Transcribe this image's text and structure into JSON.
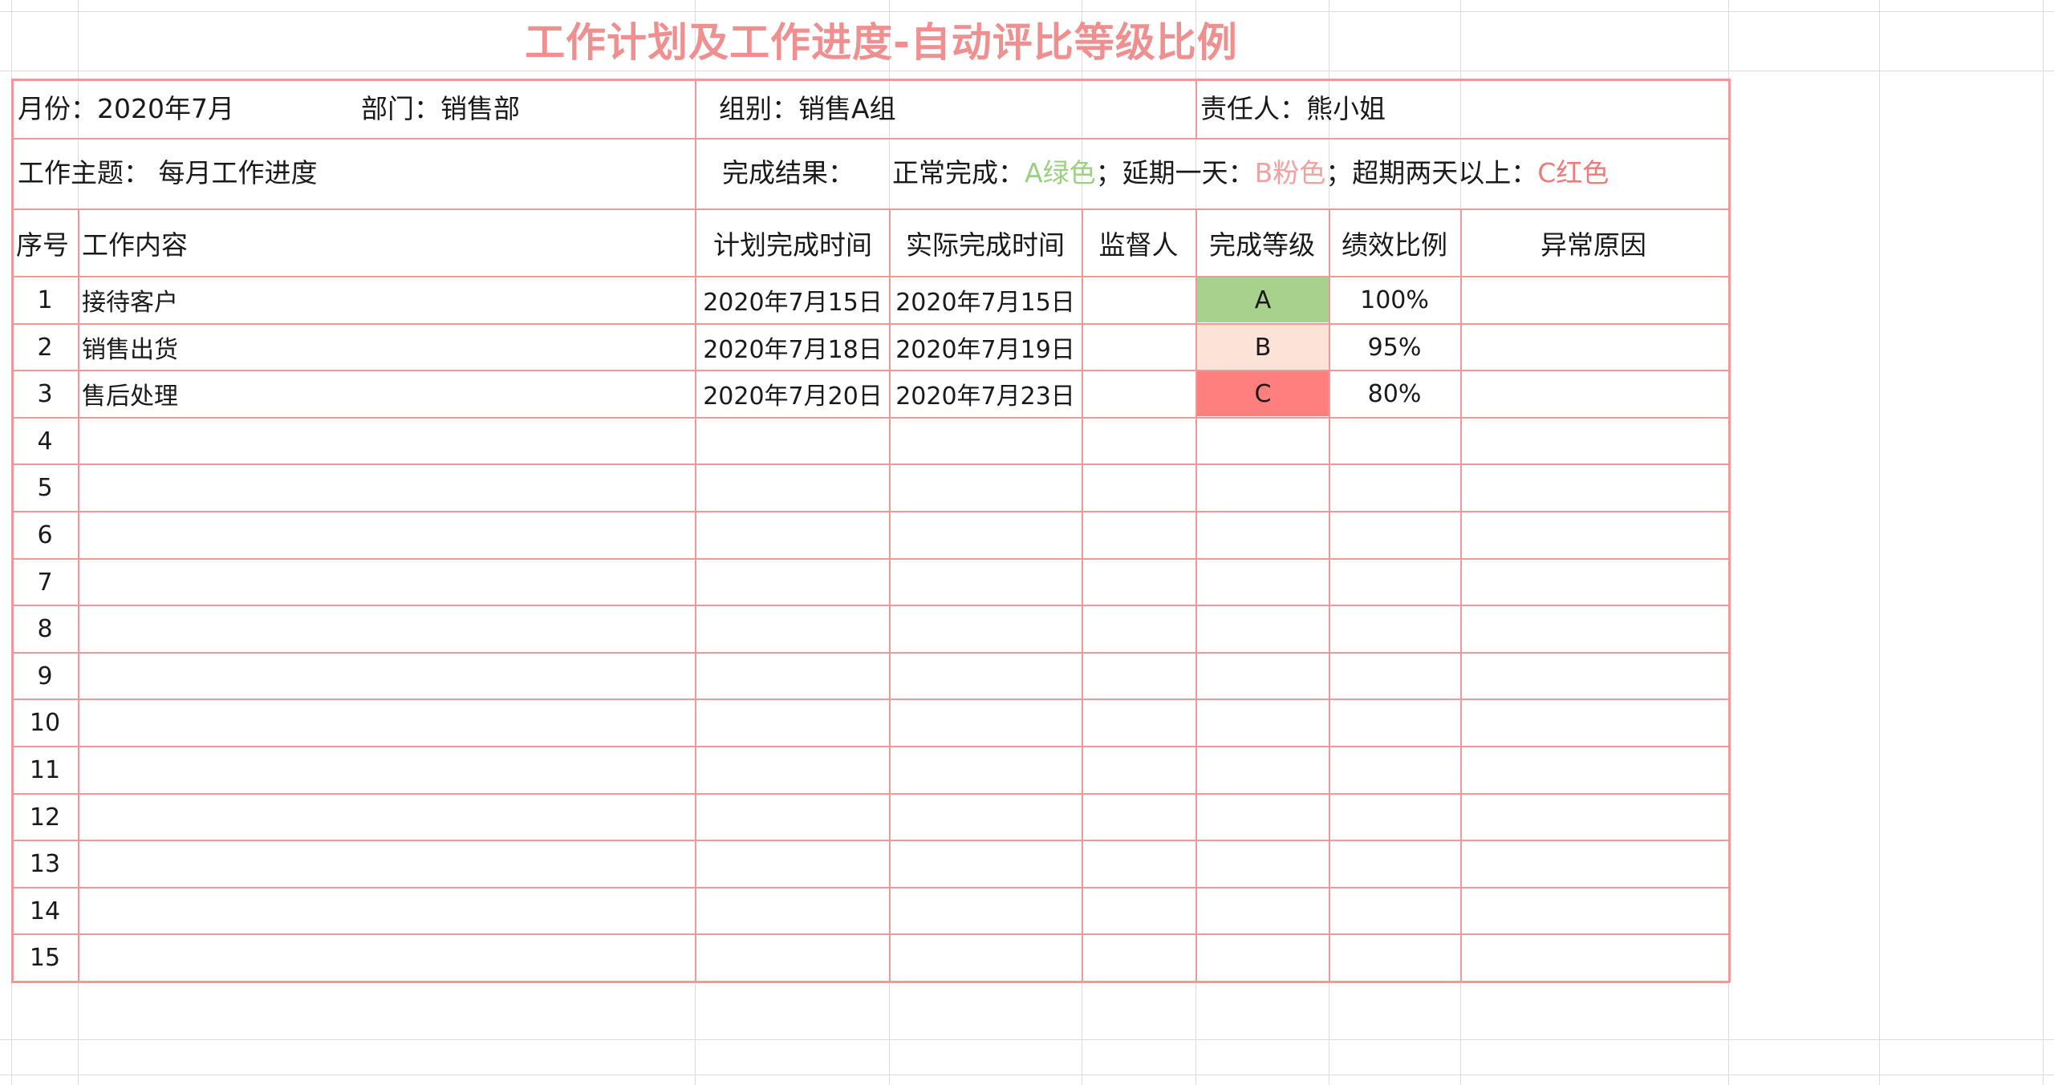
{
  "title": "工作计划及工作进度-自动评比等级比例",
  "info": {
    "month": "月份：2020年7月",
    "department": "部门：销售部",
    "group": "组别：销售A组",
    "owner": "责任人：熊小姐",
    "topic": "工作主题： 每月工作进度",
    "result_label": "完成结果：",
    "legend_normal": "正常完成：",
    "legend_a": "A绿色",
    "legend_sep1": "；延期一天：",
    "legend_b": "B粉色",
    "legend_sep2": "；超期两天以上：",
    "legend_c": "C红色"
  },
  "headers": {
    "no": "序号",
    "content": "工作内容",
    "plan": "计划完成时间",
    "actual": "实际完成时间",
    "supervisor": "监督人",
    "grade": "完成等级",
    "ratio": "绩效比例",
    "reason": "异常原因"
  },
  "rows": [
    {
      "no": "1",
      "content": "接待客户",
      "plan": "2020年7月15日",
      "actual": "2020年7月15日",
      "supervisor": "",
      "grade": "A",
      "ratio": "100%",
      "reason": ""
    },
    {
      "no": "2",
      "content": "销售出货",
      "plan": "2020年7月18日",
      "actual": "2020年7月19日",
      "supervisor": "",
      "grade": "B",
      "ratio": "95%",
      "reason": ""
    },
    {
      "no": "3",
      "content": "售后处理",
      "plan": "2020年7月20日",
      "actual": "2020年7月23日",
      "supervisor": "",
      "grade": "C",
      "ratio": "80%",
      "reason": ""
    },
    {
      "no": "4"
    },
    {
      "no": "5"
    },
    {
      "no": "6"
    },
    {
      "no": "7"
    },
    {
      "no": "8"
    },
    {
      "no": "9"
    },
    {
      "no": "10"
    },
    {
      "no": "11"
    },
    {
      "no": "12"
    },
    {
      "no": "13"
    },
    {
      "no": "14"
    },
    {
      "no": "15"
    }
  ],
  "grade_colors": {
    "A": "#a9d18e",
    "B": "#fde2d8",
    "C": "#ff7f7f"
  }
}
